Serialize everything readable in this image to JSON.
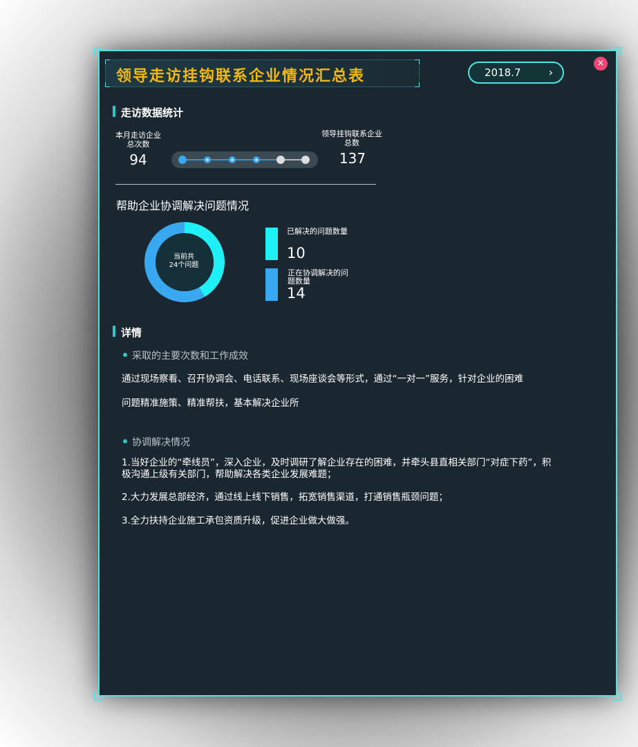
{
  "header": {
    "title": "领导走访挂钩联系企业情况汇总表",
    "date": "2018.7",
    "date_arrow": "›",
    "close": "×"
  },
  "stats": {
    "section_title": "走访数据统计",
    "left_label_line1": "本月走访企业",
    "left_label_line2": "总次数",
    "left_value": "94",
    "right_label_line1": "领导挂钩联系企业",
    "right_label_line2": "总数",
    "right_value": "137",
    "slider_progress": 0.69
  },
  "problems": {
    "title": "帮助企业协调解决问题情况",
    "center_line1": "当前共",
    "center_line2": "24个问题",
    "resolved_label": "已解决的问题数量",
    "resolved_value": "10",
    "ongoing_label_line1": "正在协调解决的问",
    "ongoing_label_line2": "题数量",
    "ongoing_value": "14",
    "colors": {
      "resolved": "#1ef0f6",
      "ongoing": "#38a8f0"
    }
  },
  "chart_data": {
    "type": "pie",
    "categories": [
      "已解决的问题数量",
      "正在协调解决的问题数量"
    ],
    "values": [
      10,
      14
    ],
    "title": "帮助企业协调解决问题情况"
  },
  "details": {
    "section_title": "详情",
    "bullet1": "采取的主要次数和工作成效",
    "para1_line1": "通过现场察看、召开协调会、电话联系、现场座谈会等形式，通过“一对一”服务，针对企业的困难",
    "para1_line2": "问题精准施策、精准帮扶，基本解决企业所",
    "bullet2": "协调解决情况",
    "item1_line1": "1.当好企业的“牵线员”，深入企业，及时调研了解企业存在的困难，并牵头县直相关部门“对症下药”，积",
    "item1_line2": "极沟通上级有关部门，帮助解决各类企业发展难题；",
    "item2": "2.大力发展总部经济，通过线上线下销售，拓宽销售渠道，打通销售瓶颈问题；",
    "item3": "3.全力扶持企业施工承包资质升级，促进企业做大做强。"
  },
  "theme": {
    "accent": "#4fe3e3",
    "title_color": "#f5b80e",
    "panel_bg": "#1b2730",
    "close_color": "#f04572"
  }
}
